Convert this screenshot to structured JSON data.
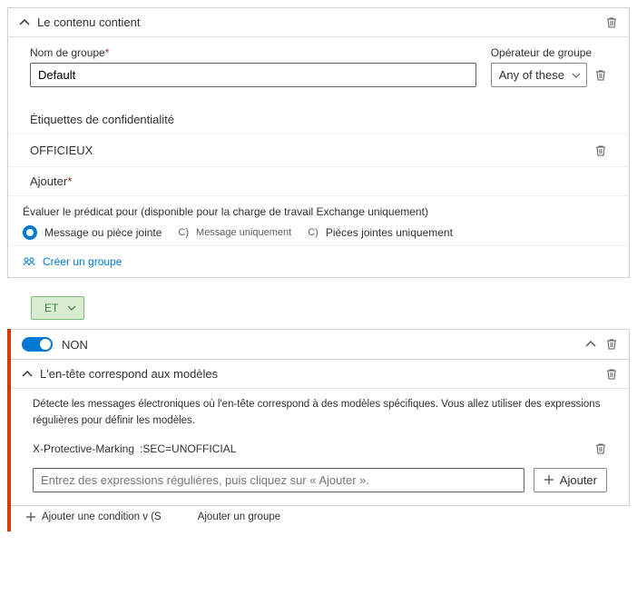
{
  "content_panel": {
    "title": "Le contenu contient",
    "group_name_label": "Nom de groupe",
    "group_name_value": "Default",
    "operator_label": "Opérateur de groupe",
    "operator_value": "Any of these",
    "sens_label_title": "Étiquettes de confidentialité",
    "sens_item": "OFFICIEUX",
    "add_link": "Ajouter",
    "eval_title": "Évaluer le prédicat pour (disponible pour la charge de travail Exchange uniquement)",
    "radio_selected": "Message ou pièce jointe",
    "opt2_prefix": "C)",
    "opt2_text": "Message uniquement",
    "opt3_prefix": "C)",
    "opt3_text": "Pièces jointes uniquement",
    "create_group": "Créer un groupe"
  },
  "connector": {
    "label": "ET"
  },
  "neg_group": {
    "non_label": "NON",
    "header_title": "L'en-tête correspond aux modèles",
    "description": "Détecte les messages électroniques où l'en-tête correspond à des modèles spécifiques. Vous allez utiliser des expressions régulières pour définir les modèles.",
    "header_name": "X-Protective-Marking",
    "header_value": ":SEC=UNOFFICIAL",
    "regex_placeholder": "Entrez des expressions régulières, puis cliquez sur « Ajouter ».",
    "add_button": "Ajouter",
    "bottom_add_cond": "Ajouter une condition v (S",
    "bottom_add_group": "Ajouter un groupe"
  },
  "icons": {
    "create_group_icon": "create-group-icon"
  }
}
